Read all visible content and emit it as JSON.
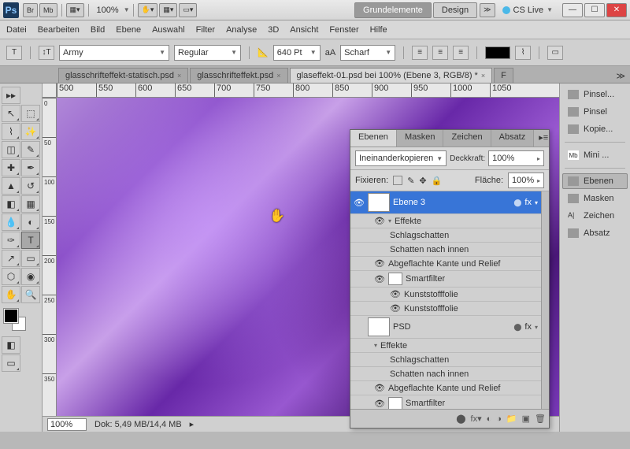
{
  "titlebar": {
    "br": "Br",
    "mb": "Mb",
    "zoom": "100%"
  },
  "workspace": {
    "active": "Grundelemente",
    "second": "Design",
    "cslive": "CS Live"
  },
  "menu": [
    "Datei",
    "Bearbeiten",
    "Bild",
    "Ebene",
    "Auswahl",
    "Filter",
    "Analyse",
    "3D",
    "Ansicht",
    "Fenster",
    "Hilfe"
  ],
  "options": {
    "font": "Army",
    "weight": "Regular",
    "size": "640 Pt",
    "aa_label": "aA",
    "aa": "Scharf"
  },
  "docs": [
    {
      "name": "glasschrifteffekt-statisch.psd",
      "active": false
    },
    {
      "name": "glasschrifteffekt.psd",
      "active": false
    },
    {
      "name": "glaseffekt-01.psd bei 100% (Ebene 3, RGB/8) *",
      "active": true
    },
    {
      "name": "F",
      "active": false
    }
  ],
  "ruler_h": [
    "500",
    "550",
    "600",
    "650",
    "700",
    "750",
    "800",
    "850",
    "900",
    "950",
    "1000",
    "1050"
  ],
  "ruler_v": [
    "0",
    "50",
    "100",
    "150",
    "200",
    "250",
    "300",
    "350"
  ],
  "status": {
    "zoom": "100%",
    "doc": "Dok: 5,49 MB/14,4 MB"
  },
  "right_panels": [
    "Pinsel...",
    "Pinsel",
    "Kopie...",
    "Mini ...",
    "Ebenen",
    "Masken",
    "Zeichen",
    "Absatz"
  ],
  "right_panel_selected": "Ebenen",
  "right_icon_labels": [
    "Mb",
    "A|"
  ],
  "layers_panel": {
    "tabs": [
      "Ebenen",
      "Masken",
      "Zeichen",
      "Absatz"
    ],
    "active_tab": "Ebenen",
    "blend": "Ineinanderkopieren",
    "opacity_label": "Deckkraft:",
    "opacity": "100%",
    "lock_label": "Fixieren:",
    "fill_label": "Fläche:",
    "fill": "100%",
    "layers": [
      {
        "name": "Ebene 3",
        "selected": true,
        "fx": "fx",
        "thumb": "txt",
        "effects": {
          "label": "Effekte",
          "items": [
            "Schlagschatten",
            "Schatten nach innen",
            "Abgeflachte Kante und Relief"
          ]
        },
        "smart": {
          "label": "Smartfilter",
          "items": [
            "Kunststofffolie",
            "Kunststofffolie"
          ]
        }
      },
      {
        "name": "PSD",
        "selected": false,
        "fx": "fx",
        "thumb": "txt",
        "effects": {
          "label": "Effekte",
          "items": [
            "Schlagschatten",
            "Schatten nach innen",
            "Abgeflachte Kante und Relief"
          ]
        },
        "smart": {
          "label": "Smartfilter",
          "items": []
        }
      }
    ]
  }
}
